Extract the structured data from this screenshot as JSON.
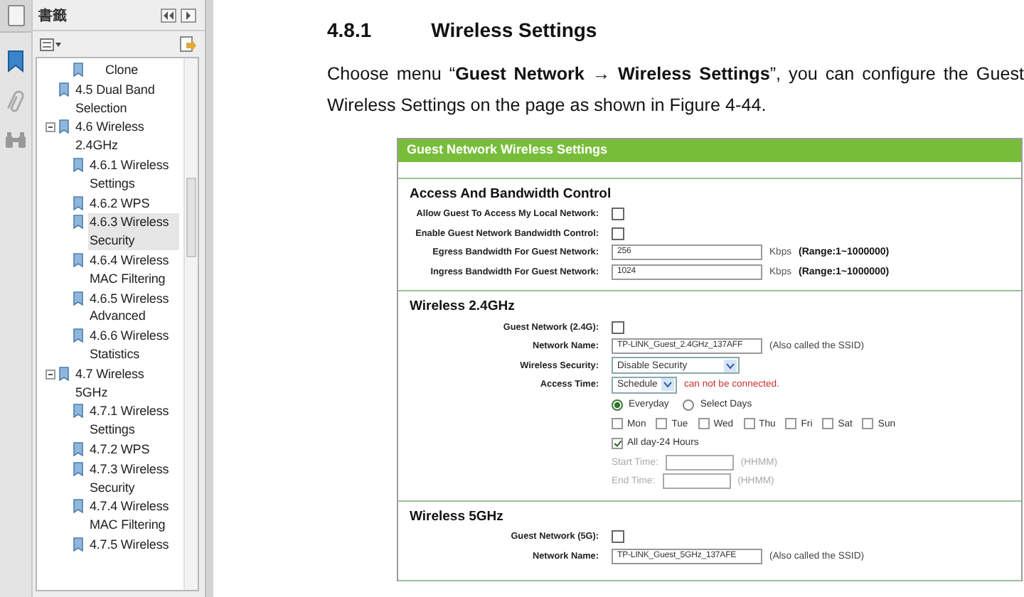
{
  "panel": {
    "title": "書籤"
  },
  "bookmarks": [
    {
      "children": [
        {
          "label": "Clone",
          "selected": false
        }
      ]
    },
    {
      "label": "4.5 Dual Band Selection",
      "selected": false
    },
    {
      "label": "4.6 Wireless 2.4GHz",
      "selected": false,
      "expanded": true,
      "children": [
        {
          "label": "4.6.1 Wireless Settings",
          "selected": false
        },
        {
          "label": "4.6.2 WPS",
          "selected": false
        },
        {
          "label": "4.6.3 Wireless Security",
          "selected": true
        },
        {
          "label": "4.6.4 Wireless MAC Filtering",
          "selected": false
        },
        {
          "label": "4.6.5 Wireless Advanced",
          "selected": false
        },
        {
          "label": "4.6.6 Wireless Statistics",
          "selected": false
        }
      ]
    },
    {
      "label": "4.7 Wireless 5GHz",
      "selected": false,
      "expanded": true,
      "children": [
        {
          "label": "4.7.1 Wireless Settings",
          "selected": false
        },
        {
          "label": "4.7.2 WPS",
          "selected": false
        },
        {
          "label": "4.7.3 Wireless Security",
          "selected": false
        },
        {
          "label": "4.7.4 Wireless MAC Filtering",
          "selected": false
        },
        {
          "label": "4.7.5 Wireless",
          "selected": false
        }
      ]
    }
  ],
  "document": {
    "number": "4.8.1",
    "heading": "Wireless Settings",
    "paragraph": "Choose menu “**Guest Network → Wireless Settings**”, you can configure the Guest Wireless Settings on the page as shown in Figure 4-44.",
    "figure": {
      "title": "Guest Network Wireless Settings",
      "sections": [
        {
          "title": "Access And Bandwidth Control",
          "rows": [
            {
              "kind": "checkbox",
              "label": "Allow Guest To Access My Local Network:",
              "checked": false
            },
            {
              "kind": "checkbox",
              "label": "Enable Guest Network Bandwidth Control:",
              "checked": false
            },
            {
              "kind": "text",
              "label": "Egress Bandwidth For Guest Network:",
              "value": "256",
              "unit": "Kbps",
              "hint": "(Range:1~1000000)",
              "hint_strong": true
            },
            {
              "kind": "text",
              "label": "Ingress Bandwidth For Guest Network:",
              "value": "1024",
              "unit": "Kbps",
              "hint": "(Range:1~1000000)",
              "hint_strong": true
            }
          ]
        },
        {
          "title": "Wireless 2.4GHz",
          "rows": [
            {
              "kind": "checkbox",
              "label": "Guest Network (2.4G):",
              "checked": false
            },
            {
              "kind": "text",
              "label": "Network Name:",
              "value": "TP-LINK_Guest_2.4GHz_137AFF",
              "hint": "(Also called the SSID)",
              "hint_strong": false
            },
            {
              "kind": "select",
              "label": "Wireless Security:",
              "value": "Disable Security",
              "wide": true
            },
            {
              "kind": "select",
              "label": "Access Time:",
              "value": "Schedule",
              "wide": false,
              "warning": "can not be connected."
            },
            {
              "kind": "radios",
              "options": [
                {
                  "label": "Everyday",
                  "selected": true
                },
                {
                  "label": "Select Days",
                  "selected": false
                }
              ]
            },
            {
              "kind": "days",
              "days": [
                {
                  "label": "Mon",
                  "checked": false
                },
                {
                  "label": "Tue",
                  "checked": false
                },
                {
                  "label": "Wed",
                  "checked": false
                },
                {
                  "label": "Thu",
                  "checked": false
                },
                {
                  "label": "Fri",
                  "checked": false
                },
                {
                  "label": "Sat",
                  "checked": false
                },
                {
                  "label": "Sun",
                  "checked": false
                }
              ]
            },
            {
              "kind": "option",
              "label": "All day-24 Hours",
              "checked": true
            },
            {
              "kind": "time",
              "label": "Start Time:",
              "hint": "(HHMM)",
              "disabled": true
            },
            {
              "kind": "time",
              "label": "End Time:",
              "hint": "(HHMM)",
              "disabled": true
            }
          ]
        },
        {
          "title": "Wireless 5GHz",
          "rows": [
            {
              "kind": "checkbox",
              "label": "Guest Network (5G):",
              "checked": false
            },
            {
              "kind": "text",
              "label": "Network Name:",
              "value": "TP-LINK_Guest_5GHz_137AFE",
              "hint": "(Also called the SSID)",
              "hint_strong": false
            }
          ]
        }
      ]
    }
  }
}
